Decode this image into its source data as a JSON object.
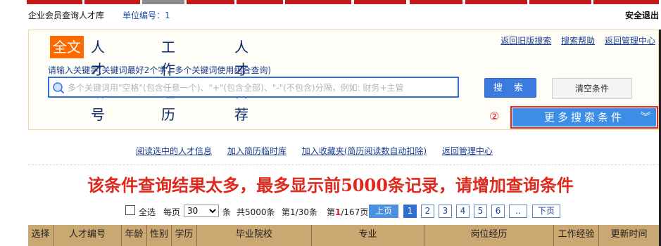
{
  "top_tabs": {
    "accent": "#c21a1a",
    "muted": "#8c8c8c"
  },
  "header": {
    "site_title": "企业会员查询人才库",
    "unit_label": "单位编号：1",
    "logout": "安全退出"
  },
  "search": {
    "modes": [
      "全文",
      "人才编号",
      "工作经历",
      "人才自荐"
    ],
    "active_mode": "全文",
    "quick_links": [
      "返回旧版搜索",
      "搜索帮助",
      "返回管理中心"
    ],
    "hint": "请输入关键字(关键词最好2个字，多个关键词使用组合查询)",
    "placeholder": "多个关键词用\"空格\"(包含任意一个)、\"+\"(包含全部)、\"-\"(不包含)分隔，例如: 财务+主管",
    "search_btn": "搜 索",
    "clear_btn": "清空条件",
    "more_btn": "更多搜索条件",
    "more_icon": "double-chevron-down-icon",
    "annotation": "②"
  },
  "actions": [
    "阅读选中的人才信息",
    "加入简历临时库",
    "加入收藏夹(简历阅读数自动扣除)",
    "返回管理中心"
  ],
  "warning": "该条件查询结果太多，最多显示前5000条记录，请增加查询条件",
  "pager": {
    "select_all": "全选",
    "per_page_label": "每页",
    "per_page_value": "30",
    "per_page_unit": "条",
    "total": "共5000条",
    "range": "第1/30条",
    "page_prefix": "第",
    "current_page": "1",
    "page_total": "/167页",
    "prev": "上页",
    "pages": [
      "1",
      "2",
      "3",
      "4",
      "5",
      "6",
      ".."
    ],
    "next": "下页"
  },
  "table": {
    "columns": [
      "选择",
      "人才编号",
      "年龄",
      "性别",
      "学历",
      "毕业院校",
      "专业",
      "岗位经历",
      "工作经验",
      "更新时间"
    ]
  }
}
